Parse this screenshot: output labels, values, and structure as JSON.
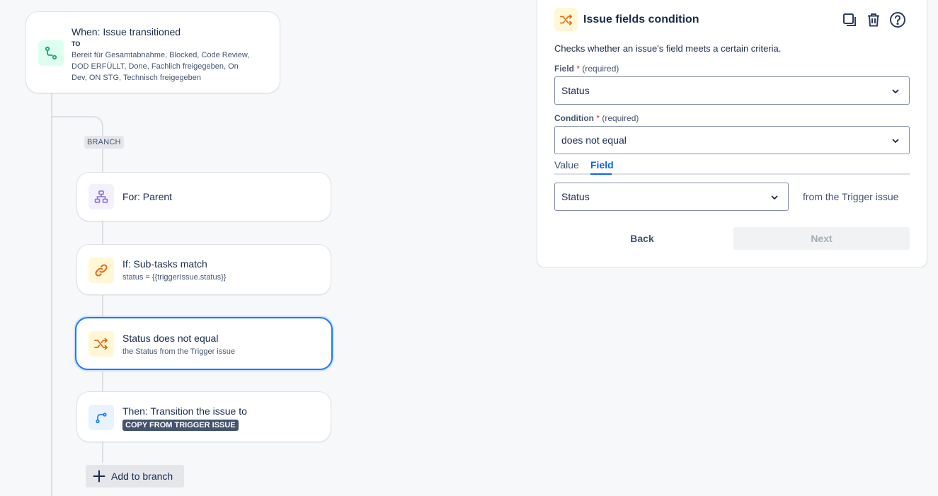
{
  "colors": {
    "accent": "#1d7afc",
    "link": "#0c66e4",
    "trigger_icon": "#22a06b",
    "branch_icon": "#8270db",
    "condition_icon": "#e56910",
    "action_icon": "#1d7afc"
  },
  "flow": {
    "trigger": {
      "icon": "transition-icon",
      "title": "When: Issue transitioned",
      "to_label": "TO",
      "statuses": "Bereit für Gesamtabnahme, Blocked, Code Review, DOD ERFÜLLT, Done, Fachlich freigegeben, On Dev, ON STG, Technisch freigegeben"
    },
    "branch_label": "BRANCH",
    "parent": {
      "icon": "hierarchy-icon",
      "title": "For: Parent"
    },
    "subtasks": {
      "icon": "link-icon",
      "title": "If: Sub-tasks match",
      "subtitle": "status = {{triggerIssue.status}}"
    },
    "status_condition": {
      "icon": "shuffle-icon",
      "title": "Status does not equal",
      "subtitle": "the Status from the Trigger issue"
    },
    "then": {
      "icon": "transition-arrow-icon",
      "title": "Then: Transition the issue to",
      "lozenge": "COPY FROM TRIGGER ISSUE"
    },
    "add_to_branch": "Add to branch"
  },
  "panel": {
    "title": "Issue fields condition",
    "description": "Checks whether an issue's field meets a certain criteria.",
    "field_label": "Field",
    "required_mark": "*",
    "required_text": "(required)",
    "field_value": "Status",
    "condition_label": "Condition",
    "condition_value": "does not equal",
    "tabs": [
      "Value",
      "Field"
    ],
    "active_tab": "Field",
    "compare_field_value": "Status",
    "from_text": "from the Trigger issue",
    "back_label": "Back",
    "next_label": "Next"
  }
}
